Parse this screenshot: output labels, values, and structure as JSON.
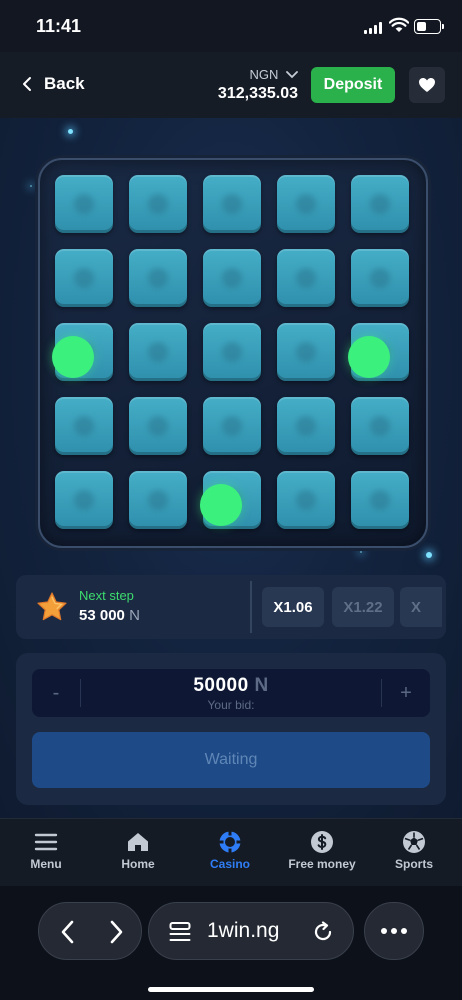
{
  "status_bar": {
    "time": "11:41"
  },
  "header": {
    "back_label": "Back",
    "currency_code": "NGN",
    "balance": "312,335.03",
    "deposit_label": "Deposit"
  },
  "board": {
    "rows": 5,
    "cols": 5,
    "revealed_gems": [
      [
        2,
        0
      ],
      [
        2,
        4
      ],
      [
        4,
        2
      ]
    ]
  },
  "next_step": {
    "label": "Next step",
    "amount": "53 000",
    "currency": "N",
    "multipliers": [
      "X1.06",
      "X1.22",
      "X"
    ]
  },
  "bet": {
    "minus_label": "-",
    "plus_label": "+",
    "value": "50000",
    "currency": "N",
    "label": "Your bid:",
    "action_label": "Waiting"
  },
  "bottom_nav": [
    {
      "label": "Menu",
      "icon": "menu-icon"
    },
    {
      "label": "Home",
      "icon": "home-icon"
    },
    {
      "label": "Casino",
      "icon": "casino-chip-icon",
      "active": true
    },
    {
      "label": "Free money",
      "icon": "dollar-coin-icon"
    },
    {
      "label": "Sports",
      "icon": "soccer-ball-icon"
    }
  ],
  "browser": {
    "url": "1win.ng"
  },
  "colors": {
    "accent_green": "#2bb14b",
    "gem_green": "#3cf07d",
    "tile_teal": "#3a9fbb",
    "active_nav": "#2f7df6"
  }
}
